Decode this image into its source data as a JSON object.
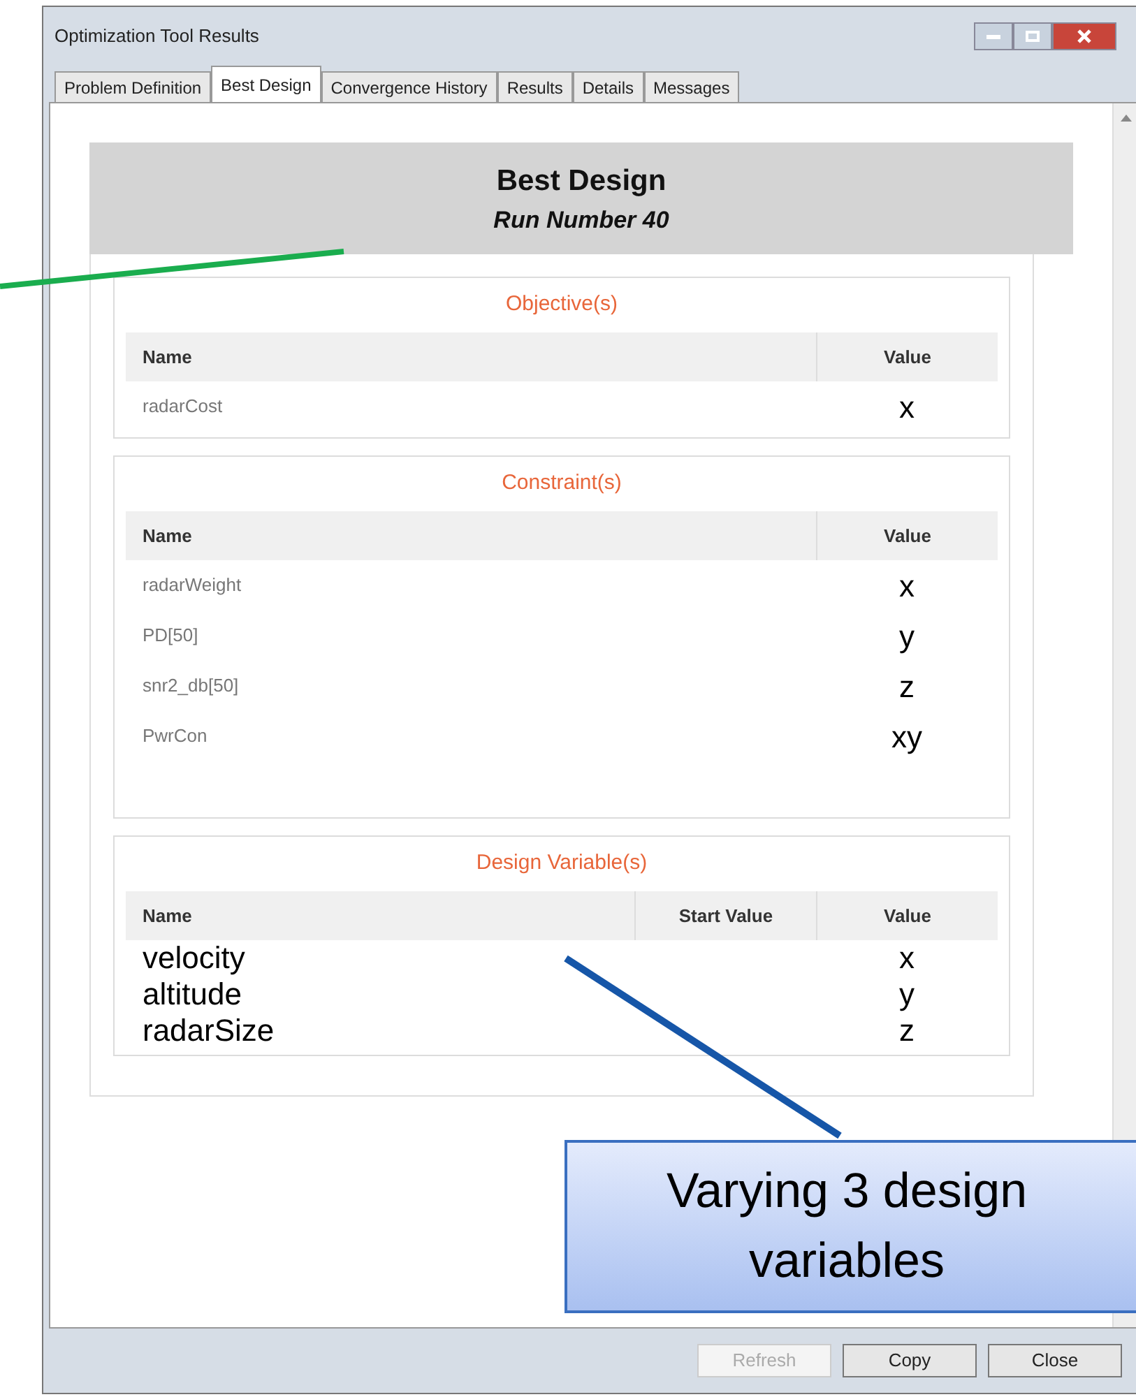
{
  "window": {
    "title": "Optimization Tool Results"
  },
  "tabs": [
    {
      "label": "Problem Definition",
      "selected": false
    },
    {
      "label": "Best Design",
      "selected": true
    },
    {
      "label": "Convergence History",
      "selected": false
    },
    {
      "label": "Results",
      "selected": false
    },
    {
      "label": "Details",
      "selected": false
    },
    {
      "label": "Messages",
      "selected": false
    }
  ],
  "header": {
    "title": "Best Design",
    "subtitle": "Run Number 40"
  },
  "sections": [
    {
      "kind": "results",
      "title": "Objective(s)",
      "columns": [
        "Name",
        "Value"
      ],
      "rows": [
        {
          "name": "radarCost",
          "value": "x"
        }
      ]
    },
    {
      "kind": "results",
      "title": "Constraint(s)",
      "columns": [
        "Name",
        "Value"
      ],
      "rows": [
        {
          "name": "radarWeight",
          "value": "x"
        },
        {
          "name": "PD[50]",
          "value": "y"
        },
        {
          "name": "snr2_db[50]",
          "value": "z"
        },
        {
          "name": "PwrCon",
          "value": "xy"
        }
      ]
    },
    {
      "kind": "variables",
      "title": "Design Variable(s)",
      "columns": [
        "Name",
        "Start Value",
        "Value"
      ],
      "rows": [
        {
          "name": "velocity",
          "value": "x"
        },
        {
          "name": "altitude",
          "value": "y"
        },
        {
          "name": "radarSize",
          "value": "z"
        }
      ]
    }
  ],
  "callout": {
    "text": "Varying 3 design variables"
  },
  "buttons": [
    {
      "label": "Refresh",
      "disabled": true
    },
    {
      "label": "Copy",
      "disabled": false
    },
    {
      "label": "Close",
      "disabled": false
    }
  ]
}
